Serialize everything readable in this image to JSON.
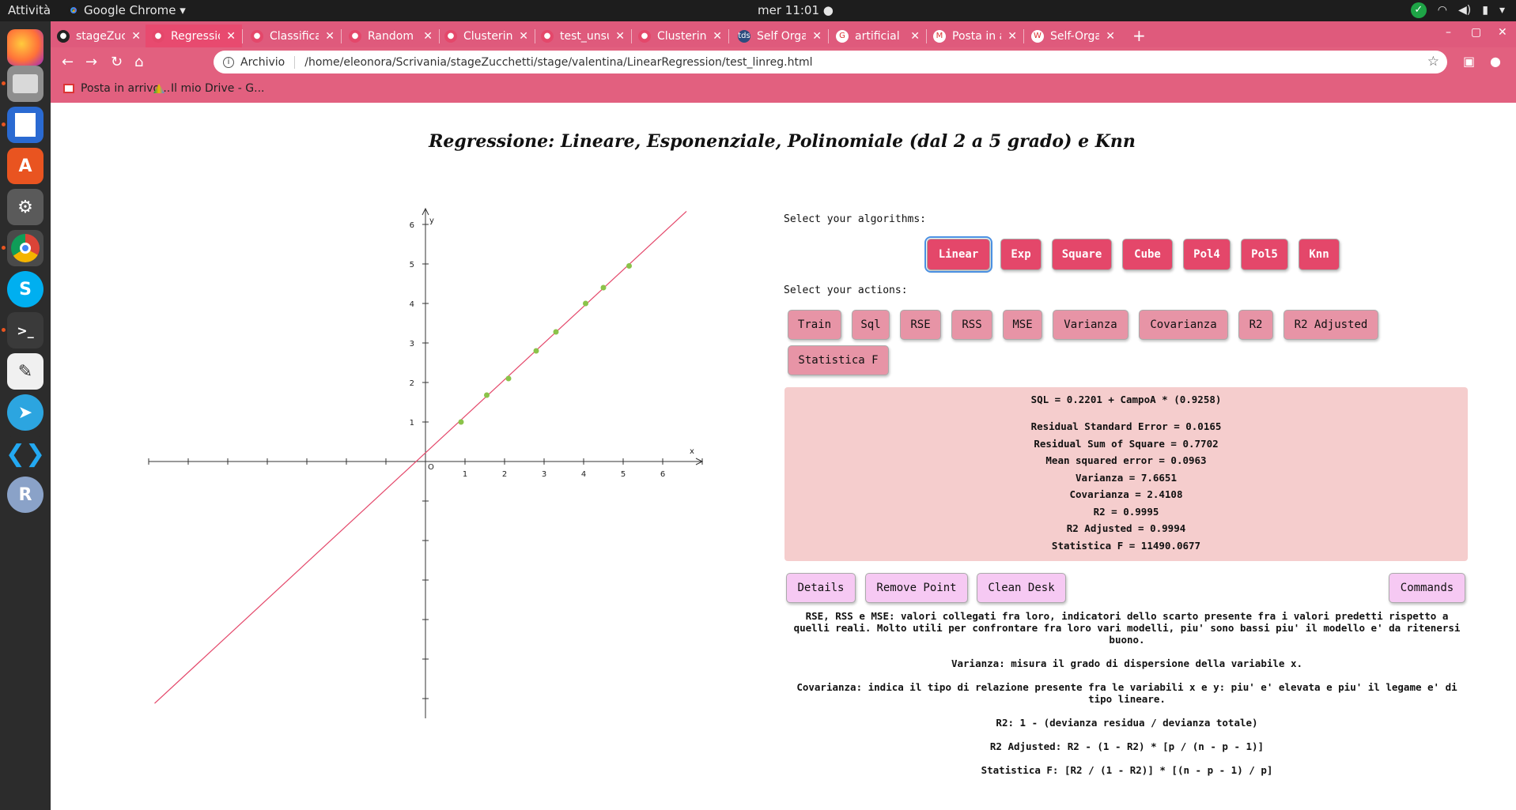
{
  "topbar": {
    "activities": "Attività",
    "app_name": "Google Chrome ▾",
    "clock": "mer 11:01 ●"
  },
  "tabs": [
    {
      "label": "stageZucche",
      "icon": "github-icon"
    },
    {
      "label": "Regression",
      "icon": "page-icon",
      "active": true
    },
    {
      "label": "Classificatio",
      "icon": "page-icon"
    },
    {
      "label": "Random Fore",
      "icon": "page-icon"
    },
    {
      "label": "Clustering",
      "icon": "page-icon"
    },
    {
      "label": "test_unsupe",
      "icon": "page-icon"
    },
    {
      "label": "Clustering.p",
      "icon": "page-icon"
    },
    {
      "label": "Self Organiz",
      "icon": "tds-icon"
    },
    {
      "label": "artificial neu",
      "icon": "google-icon"
    },
    {
      "label": "Posta in arri",
      "icon": "gmail-icon"
    },
    {
      "label": "Self-Organiz",
      "icon": "wikipedia-icon"
    }
  ],
  "omnibar": {
    "security_label": "Archivio",
    "url": "/home/eleonora/Scrivania/stageZucchetti/stage/valentina/LinearRegression/test_linreg.html"
  },
  "bookmarks": [
    {
      "label": "Posta in arrivo..."
    },
    {
      "label": "Il mio Drive - G..."
    }
  ],
  "page": {
    "title": "Regressione: Lineare, Esponenziale, Polinomiale (dal 2 a 5 grado) e Knn",
    "select_algorithms_label": "Select your algorithms:",
    "select_actions_label": "Select your actions:",
    "algorithms": [
      "Linear",
      "Exp",
      "Square",
      "Cube",
      "Pol4",
      "Pol5",
      "Knn"
    ],
    "selected_algorithm": "Linear",
    "actions": [
      "Train",
      "Sql",
      "RSE",
      "RSS",
      "MSE",
      "Varianza",
      "Covarianza",
      "R2",
      "R2 Adjusted",
      "Statistica F"
    ],
    "results": [
      "SQL = 0.2201 + CampoA * (0.9258)",
      "Residual Standard Error = 0.0165",
      "Residual Sum of Square = 0.7702",
      "Mean squared error = 0.0963",
      "Varianza = 7.6651",
      "Covarianza = 2.4108",
      "R2 = 0.9995",
      "R2 Adjusted = 0.9994",
      "Statistica F = 11490.0677"
    ],
    "bottom_buttons": {
      "details": "Details",
      "remove_point": "Remove Point",
      "clean_desk": "Clean Desk",
      "commands": "Commands"
    },
    "notes": [
      "RSE, RSS e MSE: valori collegati fra loro, indicatori dello scarto presente fra i valori predetti rispetto a quelli reali. Molto utili per confrontare fra loro vari modelli, piu' sono bassi piu' il modello e' da ritenersi buono.",
      "Varianza: misura il grado di dispersione della variabile x.",
      "Covarianza: indica il tipo di relazione presente fra le variabili x e y: piu' e' elevata e piu' il legame e' di tipo lineare.",
      "R2: 1 - (devianza residua / devianza totale)",
      "R2 Adjusted: R2 - (1 - R2) * [p / (n - p - 1)]",
      "Statistica F: [R2 / (1 - R2)] * [(n - p - 1) / p]"
    ]
  },
  "chart_data": {
    "type": "scatter",
    "xlabel": "x",
    "ylabel": "y",
    "origin_label": "O",
    "xlim": [
      -7,
      7
    ],
    "ylim": [
      -6.5,
      6.4
    ],
    "x_tick_labels": [
      "1",
      "2",
      "3",
      "4",
      "5",
      "6"
    ],
    "y_tick_labels": [
      "1",
      "2",
      "3",
      "4",
      "5",
      "6"
    ],
    "points": [
      {
        "x": 0.9,
        "y": 1.0
      },
      {
        "x": 1.55,
        "y": 1.68
      },
      {
        "x": 2.1,
        "y": 2.1
      },
      {
        "x": 2.8,
        "y": 2.8
      },
      {
        "x": 3.3,
        "y": 3.28
      },
      {
        "x": 4.05,
        "y": 4.0
      },
      {
        "x": 4.5,
        "y": 4.4
      },
      {
        "x": 5.15,
        "y": 4.95
      }
    ],
    "regression_line": {
      "intercept": 0.2201,
      "slope": 0.9258
    },
    "point_color": "#8bc34a",
    "line_color": "#e4476a"
  },
  "colors": {
    "chrome_frame": "#df5a7c",
    "algo_button": "#e4476a",
    "action_button": "#e794a6",
    "results_bg": "#f5cdcd",
    "utility_button": "#f6c9f3"
  }
}
